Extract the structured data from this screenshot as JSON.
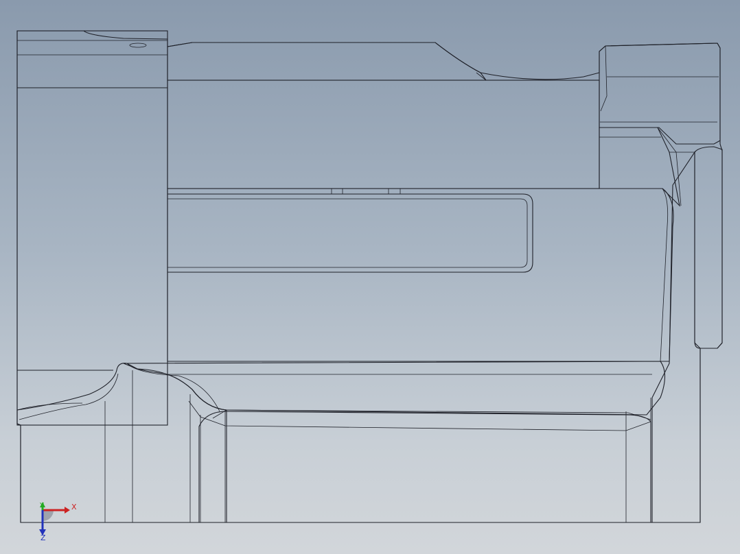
{
  "viewport": {
    "background_top": "#8a9aad",
    "background_bottom": "#d2d6da",
    "face_color": "#72778a",
    "edge_color": "#1e2028"
  },
  "triad": {
    "x_label": "X",
    "y_label": "Y",
    "z_label": "Z",
    "x_color": "#cc2222",
    "y_color": "#22aa22",
    "z_color": "#2233bb",
    "x_icon": "arrow-right-icon",
    "y_icon": "arrow-up-icon",
    "z_icon": "arrow-down-icon"
  }
}
